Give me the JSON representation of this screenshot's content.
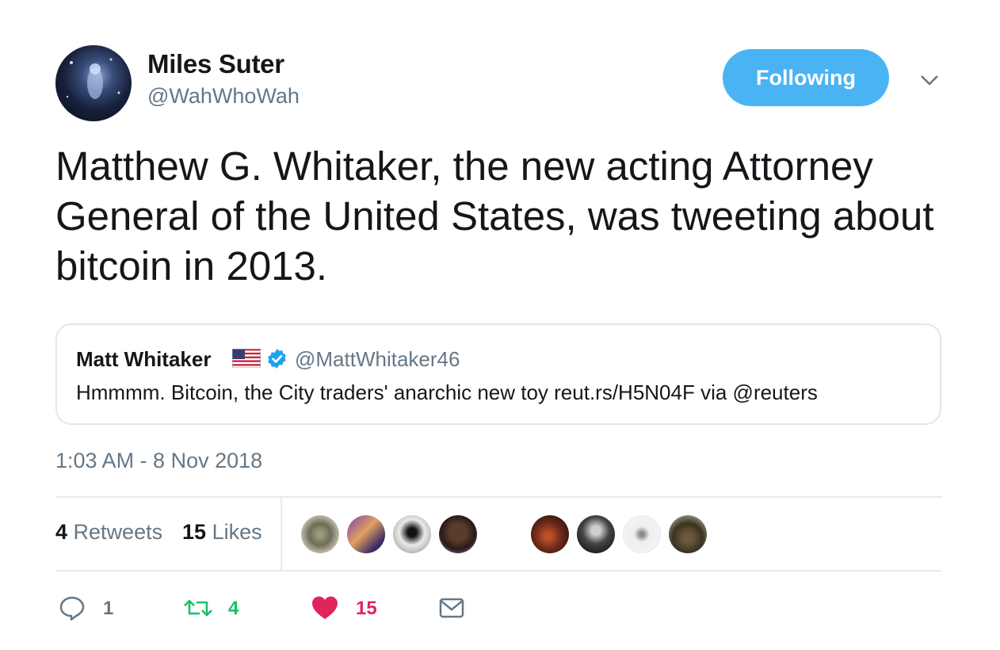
{
  "author": {
    "display_name": "Miles Suter",
    "handle": "@WahWhoWah",
    "avatar_icon": "profile-avatar-image"
  },
  "follow_button": {
    "label": "Following",
    "color": "#4ab3f4"
  },
  "menu_caret_icon": "chevron-down-icon",
  "tweet": {
    "text": "Matthew G. Whitaker, the new acting Attorney General of the United States, was tweeting about bitcoin in 2013."
  },
  "quoted_tweet": {
    "display_name": "Matt Whitaker",
    "flag_icon": "us-flag-icon",
    "verified_icon": "verified-badge-icon",
    "handle": "@MattWhitaker46",
    "text": "Hmmmm.  Bitcoin, the City traders' anarchic new toy reut.rs/H5N04F via @reuters"
  },
  "timestamp": "1:03 AM - 8 Nov 2018",
  "stats": {
    "retweets_count": "4",
    "retweets_label": "Retweets",
    "likes_count": "15",
    "likes_label": "Likes",
    "likers_icons": [
      "liker-avatar-1",
      "liker-avatar-2",
      "liker-avatar-3",
      "liker-avatar-4",
      "liker-avatar-5",
      "liker-avatar-6",
      "liker-avatar-7",
      "liker-avatar-8"
    ]
  },
  "actions": {
    "reply_count": "1",
    "retweet_count": "4",
    "like_count": "15",
    "colors": {
      "reply": "#657786",
      "retweet": "#17bf63",
      "like": "#e0245e"
    }
  }
}
